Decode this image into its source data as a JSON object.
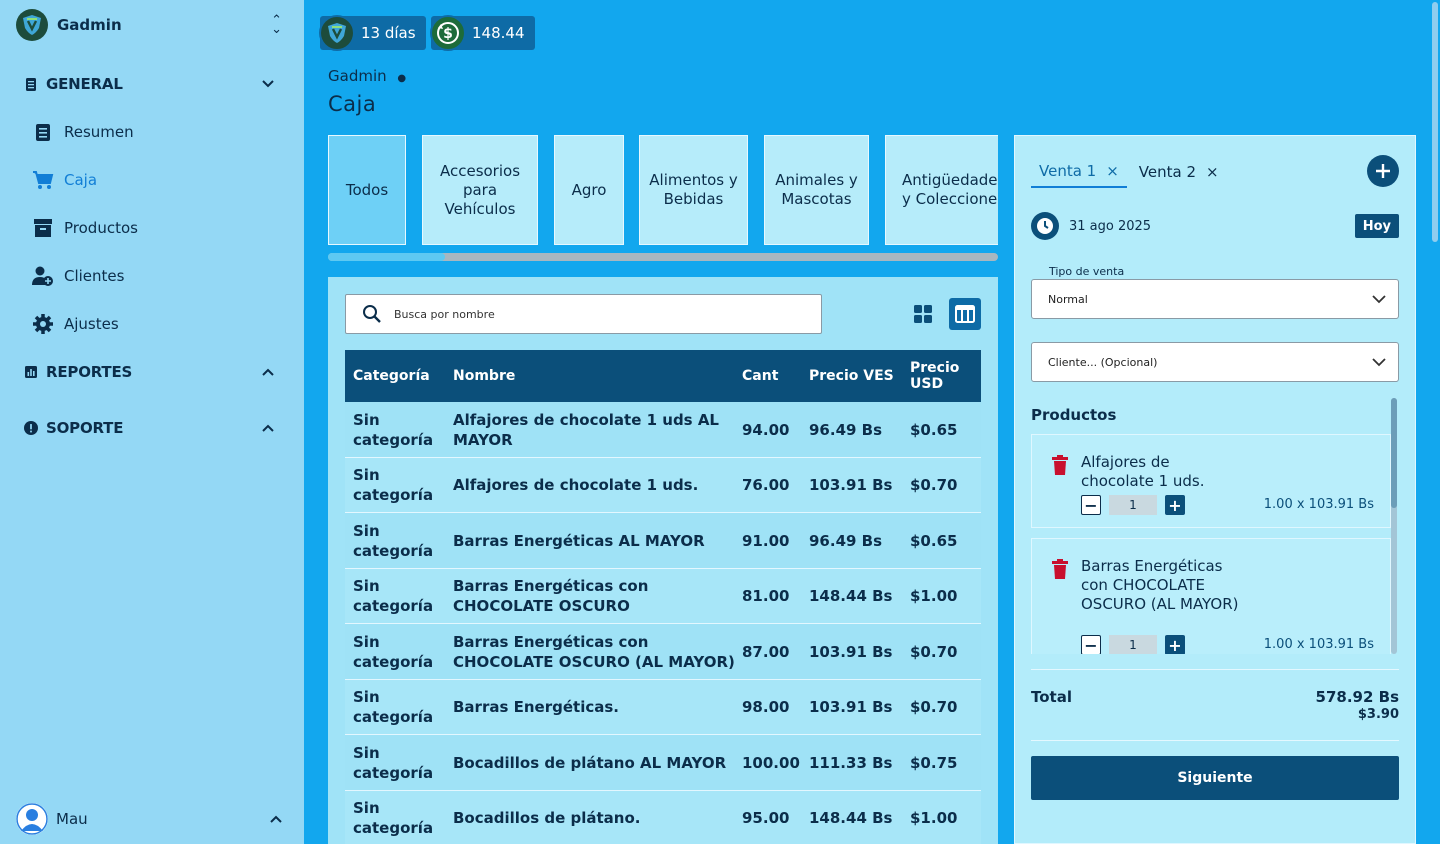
{
  "app": {
    "name": "Gadmin"
  },
  "sidebar": {
    "sections": [
      {
        "label": "GENERAL",
        "icon": "document-icon",
        "expanded": true
      },
      {
        "label": "REPORTES",
        "icon": "chart-icon",
        "expanded": false
      },
      {
        "label": "SOPORTE",
        "icon": "alert-icon",
        "expanded": false
      }
    ],
    "items": [
      {
        "label": "Resumen",
        "icon": "document-icon"
      },
      {
        "label": "Caja",
        "icon": "cart-icon",
        "active": true
      },
      {
        "label": "Productos",
        "icon": "archive-icon"
      },
      {
        "label": "Clientes",
        "icon": "user-add-icon"
      },
      {
        "label": "Ajustes",
        "icon": "gear-icon"
      }
    ],
    "user": {
      "name": "Mau"
    }
  },
  "header": {
    "days_badge": "13 días",
    "rate_badge": "148.44",
    "breadcrumb": "Gadmin",
    "title": "Caja"
  },
  "categories": [
    "Todos",
    "Accesorios para Vehículos",
    "Agro",
    "Alimentos y Bebidas",
    "Animales y Mascotas",
    "Antigüedades y Colecciones"
  ],
  "search": {
    "placeholder": "Busca por nombre"
  },
  "table": {
    "headers": [
      "Categoría",
      "Nombre",
      "Cant",
      "Precio VES",
      "Precio USD"
    ],
    "rows": [
      [
        "Sin categoría",
        "Alfajores de chocolate 1 uds AL MAYOR",
        "94.00",
        "96.49 Bs",
        "$0.65"
      ],
      [
        "Sin categoría",
        "Alfajores de chocolate 1 uds.",
        "76.00",
        "103.91 Bs",
        "$0.70"
      ],
      [
        "Sin categoría",
        "Barras Energéticas AL MAYOR",
        "91.00",
        "96.49 Bs",
        "$0.65"
      ],
      [
        "Sin categoría",
        "Barras Energéticas con CHOCOLATE OSCURO",
        "81.00",
        "148.44 Bs",
        "$1.00"
      ],
      [
        "Sin categoría",
        "Barras Energéticas con CHOCOLATE OSCURO (AL MAYOR)",
        "87.00",
        "103.91 Bs",
        "$0.70"
      ],
      [
        "Sin categoría",
        "Barras Energéticas.",
        "98.00",
        "103.91 Bs",
        "$0.70"
      ],
      [
        "Sin categoría",
        "Bocadillos de plátano AL MAYOR",
        "100.00",
        "111.33 Bs",
        "$0.75"
      ],
      [
        "Sin categoría",
        "Bocadillos de plátano.",
        "95.00",
        "148.44 Bs",
        "$1.00"
      ]
    ]
  },
  "sale": {
    "tabs": [
      "Venta 1",
      "Venta 2"
    ],
    "tab_close": "×",
    "date": "31 ago 2025",
    "today_label": "Hoy",
    "type_label": "Tipo de venta",
    "type_value": "Normal",
    "client_placeholder": "Cliente... (Opcional)",
    "products_title": "Productos",
    "items": [
      {
        "name": "Alfajores de chocolate 1 uds.",
        "qty": "1",
        "price_line": "1.00 x 103.91 Bs"
      },
      {
        "name": "Barras Energéticas con CHOCOLATE OSCURO (AL MAYOR)",
        "qty": "1",
        "price_line": "1.00 x 103.91 Bs"
      }
    ],
    "total_label": "Total",
    "total_ves": "578.92 Bs",
    "total_usd": "$3.90",
    "next_label": "Siguiente"
  },
  "colors": {
    "sidebar": "#94d8f5",
    "main": "#12a7ee",
    "primary": "#0b4f7a",
    "accent": "#117ed6",
    "danger": "#c8102e"
  }
}
